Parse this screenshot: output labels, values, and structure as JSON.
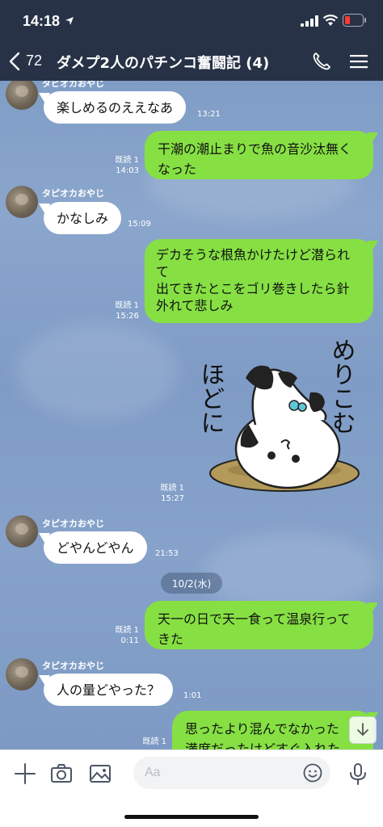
{
  "status_bar": {
    "time": "14:18"
  },
  "nav": {
    "back_count": "72",
    "title": "ダメプ2人のパチンコ奮闘記 (4)"
  },
  "messages": [
    {
      "id": "m1",
      "dir": "in",
      "sender": "タピオカおやじ",
      "text": "楽しめるのええなあ",
      "time": "13:21"
    },
    {
      "id": "m2",
      "dir": "out",
      "lines": [
        "干潮の潮止まりで魚の音沙汰無く",
        "なった"
      ],
      "read": "既読 1",
      "time": "14:03"
    },
    {
      "id": "m3",
      "dir": "in",
      "sender": "タピオカおやじ",
      "text": "かなしみ",
      "time": "15:09"
    },
    {
      "id": "m4",
      "dir": "out",
      "lines": [
        "デカそうな根魚かけたけど潜られ",
        "て",
        "出てきたとこをゴリ巻きしたら針",
        "外れて悲しみ"
      ],
      "read": "既読 1",
      "time": "15:26"
    },
    {
      "id": "m5",
      "dir": "out",
      "type": "sticker",
      "sticker_text_left": "ほどに",
      "sticker_text_right": "めりこむ",
      "read": "既読 1",
      "time": "15:27"
    },
    {
      "id": "m6",
      "dir": "in",
      "sender": "タピオカおやじ",
      "text": "どやんどやん",
      "time": "21:53"
    },
    {
      "id": "m7",
      "dir": "out",
      "lines": [
        "天一の日で天一食って温泉行って",
        "きた"
      ],
      "read": "既読 1",
      "time": "0:11"
    },
    {
      "id": "m8",
      "dir": "in",
      "sender": "タピオカおやじ",
      "text": "人の量どやった？",
      "time": "1:01"
    },
    {
      "id": "m9",
      "dir": "out",
      "lines": [
        "思ったより混んでなかった",
        "満席だったけどすぐ入れた"
      ],
      "read": "既読 1",
      "time": ""
    }
  ],
  "date_separator": "10/2(水)",
  "composer": {
    "placeholder": "Aa"
  },
  "colors": {
    "nav_bg": "#273246",
    "out_bubble": "#86e043",
    "in_bubble": "#ffffff",
    "chat_bg": "#819ec7"
  },
  "icons": [
    "location-arrow-icon",
    "signal-icon",
    "wifi-icon",
    "battery-icon",
    "back-chevron-icon",
    "phone-icon",
    "menu-icon",
    "plus-icon",
    "camera-icon",
    "image-icon",
    "emoji-icon",
    "microphone-icon",
    "arrow-down-icon"
  ]
}
